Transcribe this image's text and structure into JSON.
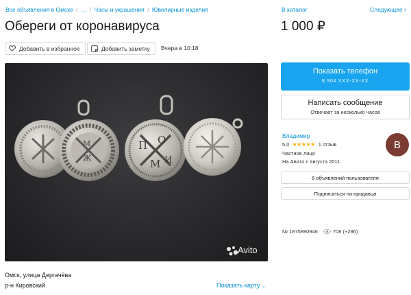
{
  "breadcrumb": {
    "items": [
      "Все объявления в Омске",
      "…",
      "Часы и украшения",
      "Ювелирные изделия"
    ],
    "separator": "/"
  },
  "listing": {
    "title": "Обереги от коронавируса",
    "actions": {
      "favorite_label": "Добавить в избранное",
      "note_label": "Добавить заметку"
    },
    "posted": "Вчера в 10:18",
    "photo": {
      "watermark": "Avito",
      "background_color": "#2a2a2c",
      "item_color": "#c8c6c1"
    },
    "address": {
      "line1": "Омск, улица Дергачёва",
      "line2": "р-н Кировский",
      "map_link": "Показать карту"
    }
  },
  "sidebar": {
    "catalog_link": "В каталог",
    "next_link": "Следующее",
    "price": "1 000 ₽",
    "phone_button": {
      "label": "Показать телефон",
      "masked_number": "8 904 XXX-XX-XX",
      "color": "#19a4ef"
    },
    "message_button": {
      "label": "Написать сообщение",
      "subtitle": "Отвечает за несколько часов"
    },
    "seller": {
      "name": "Владимир",
      "rating": "5,0",
      "stars": 5,
      "reviews": "1 отзыв",
      "type": "Частное лицо",
      "since": "На Авито с августа 2011",
      "avatar_letter": "В",
      "avatar_color": "#7a3b33"
    },
    "seller_ads_button": "8 объявлений пользователя",
    "subscribe_button": "Подписаться на продавца",
    "meta": {
      "ad_number": "№ 1875890946",
      "views": "708 (+286)"
    }
  }
}
